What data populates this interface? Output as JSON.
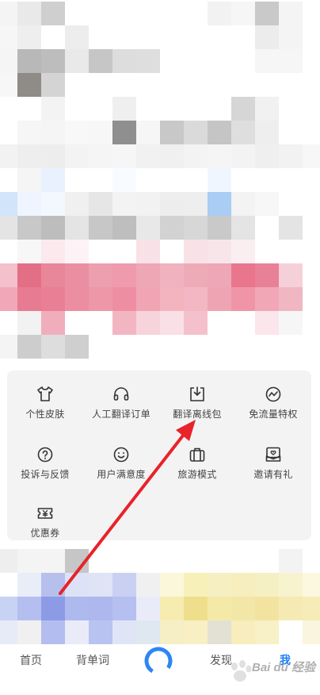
{
  "tools": [
    {
      "label": "个性皮肤",
      "icon": "tshirt-icon",
      "col": 0,
      "row": 0
    },
    {
      "label": "人工翻译订单",
      "icon": "headphones-icon",
      "col": 1,
      "row": 0
    },
    {
      "label": "翻译离线包",
      "icon": "download-package-icon",
      "col": 2,
      "row": 0
    },
    {
      "label": "免流量特权",
      "icon": "traffic-wave-icon",
      "col": 3,
      "row": 0
    },
    {
      "label": "投诉与反馈",
      "icon": "question-circle-icon",
      "col": 0,
      "row": 1
    },
    {
      "label": "用户满意度",
      "icon": "smile-icon",
      "col": 1,
      "row": 1
    },
    {
      "label": "旅游模式",
      "icon": "suitcase-icon",
      "col": 2,
      "row": 1
    },
    {
      "label": "邀请有礼",
      "icon": "gift-envelope-icon",
      "col": 3,
      "row": 1
    },
    {
      "label": "优惠券",
      "icon": "coupon-icon",
      "col": 0,
      "row": 2
    }
  ],
  "tabbar": {
    "home": "首页",
    "words": "背单词",
    "discover": "发现",
    "me": "我"
  },
  "watermark": "Bai du 经验",
  "colors": {
    "icon": "#333333",
    "active_tab": "#1d7cf2",
    "arrow": "#e8232a",
    "panel": "#f3f3f4"
  }
}
